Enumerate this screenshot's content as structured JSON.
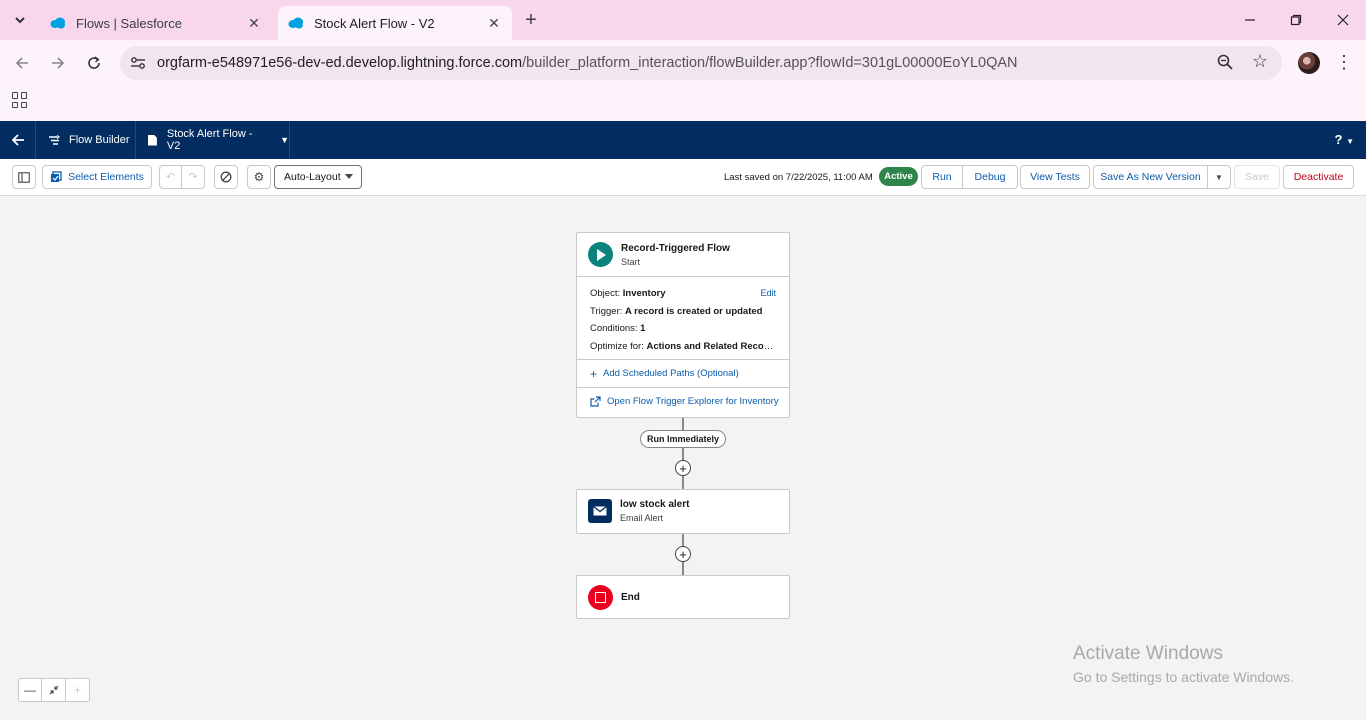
{
  "browser": {
    "tabs": [
      {
        "title": "Flows | Salesforce",
        "active": false
      },
      {
        "title": "Stock Alert Flow - V2",
        "active": true
      }
    ],
    "url_host": "orgfarm-e548971e56-dev-ed.develop.lightning.force.com",
    "url_path": "/builder_platform_interaction/flowBuilder.app?flowId=301gL00000EoYL0QAN",
    "colors": {
      "tabbar": "#f8d7ec",
      "toolbar": "#fdf3fa",
      "omnibox": "#f2e5ee"
    }
  },
  "header": {
    "app_name": "Flow Builder",
    "flow_name": "Stock Alert Flow - V2",
    "help_label": "?",
    "color": "#032d60"
  },
  "toolbar": {
    "select_elements": "Select Elements",
    "layout_value": "Auto-Layout",
    "last_saved": "Last saved on 7/22/2025, 11:00 AM",
    "status": "Active",
    "run": "Run",
    "debug": "Debug",
    "view_tests": "View Tests",
    "save_as_new_version": "Save As New Version",
    "save": "Save",
    "deactivate": "Deactivate",
    "status_color": "#2e844a"
  },
  "canvas": {
    "start": {
      "title": "Record-Triggered Flow",
      "subtitle": "Start",
      "object_label": "Object:",
      "object_value": "Inventory",
      "edit_label": "Edit",
      "trigger_label": "Trigger:",
      "trigger_value": "A record is created or updated",
      "conditions_label": "Conditions:",
      "conditions_value": "1",
      "optimize_label": "Optimize for:",
      "optimize_value": "Actions and Related Records",
      "add_scheduled_paths": "Add Scheduled Paths (Optional)",
      "open_trigger_explorer": "Open Flow Trigger Explorer for Inventory",
      "icon_color": "#0b827c"
    },
    "path_label": "Run Immediately",
    "email_alert": {
      "title": "low stock alert",
      "subtitle": "Email Alert",
      "icon_color": "#032d60"
    },
    "end": {
      "title": "End",
      "icon_color": "#ea001e"
    }
  },
  "watermark": {
    "line1": "Activate Windows",
    "line2": "Go to Settings to activate Windows."
  }
}
